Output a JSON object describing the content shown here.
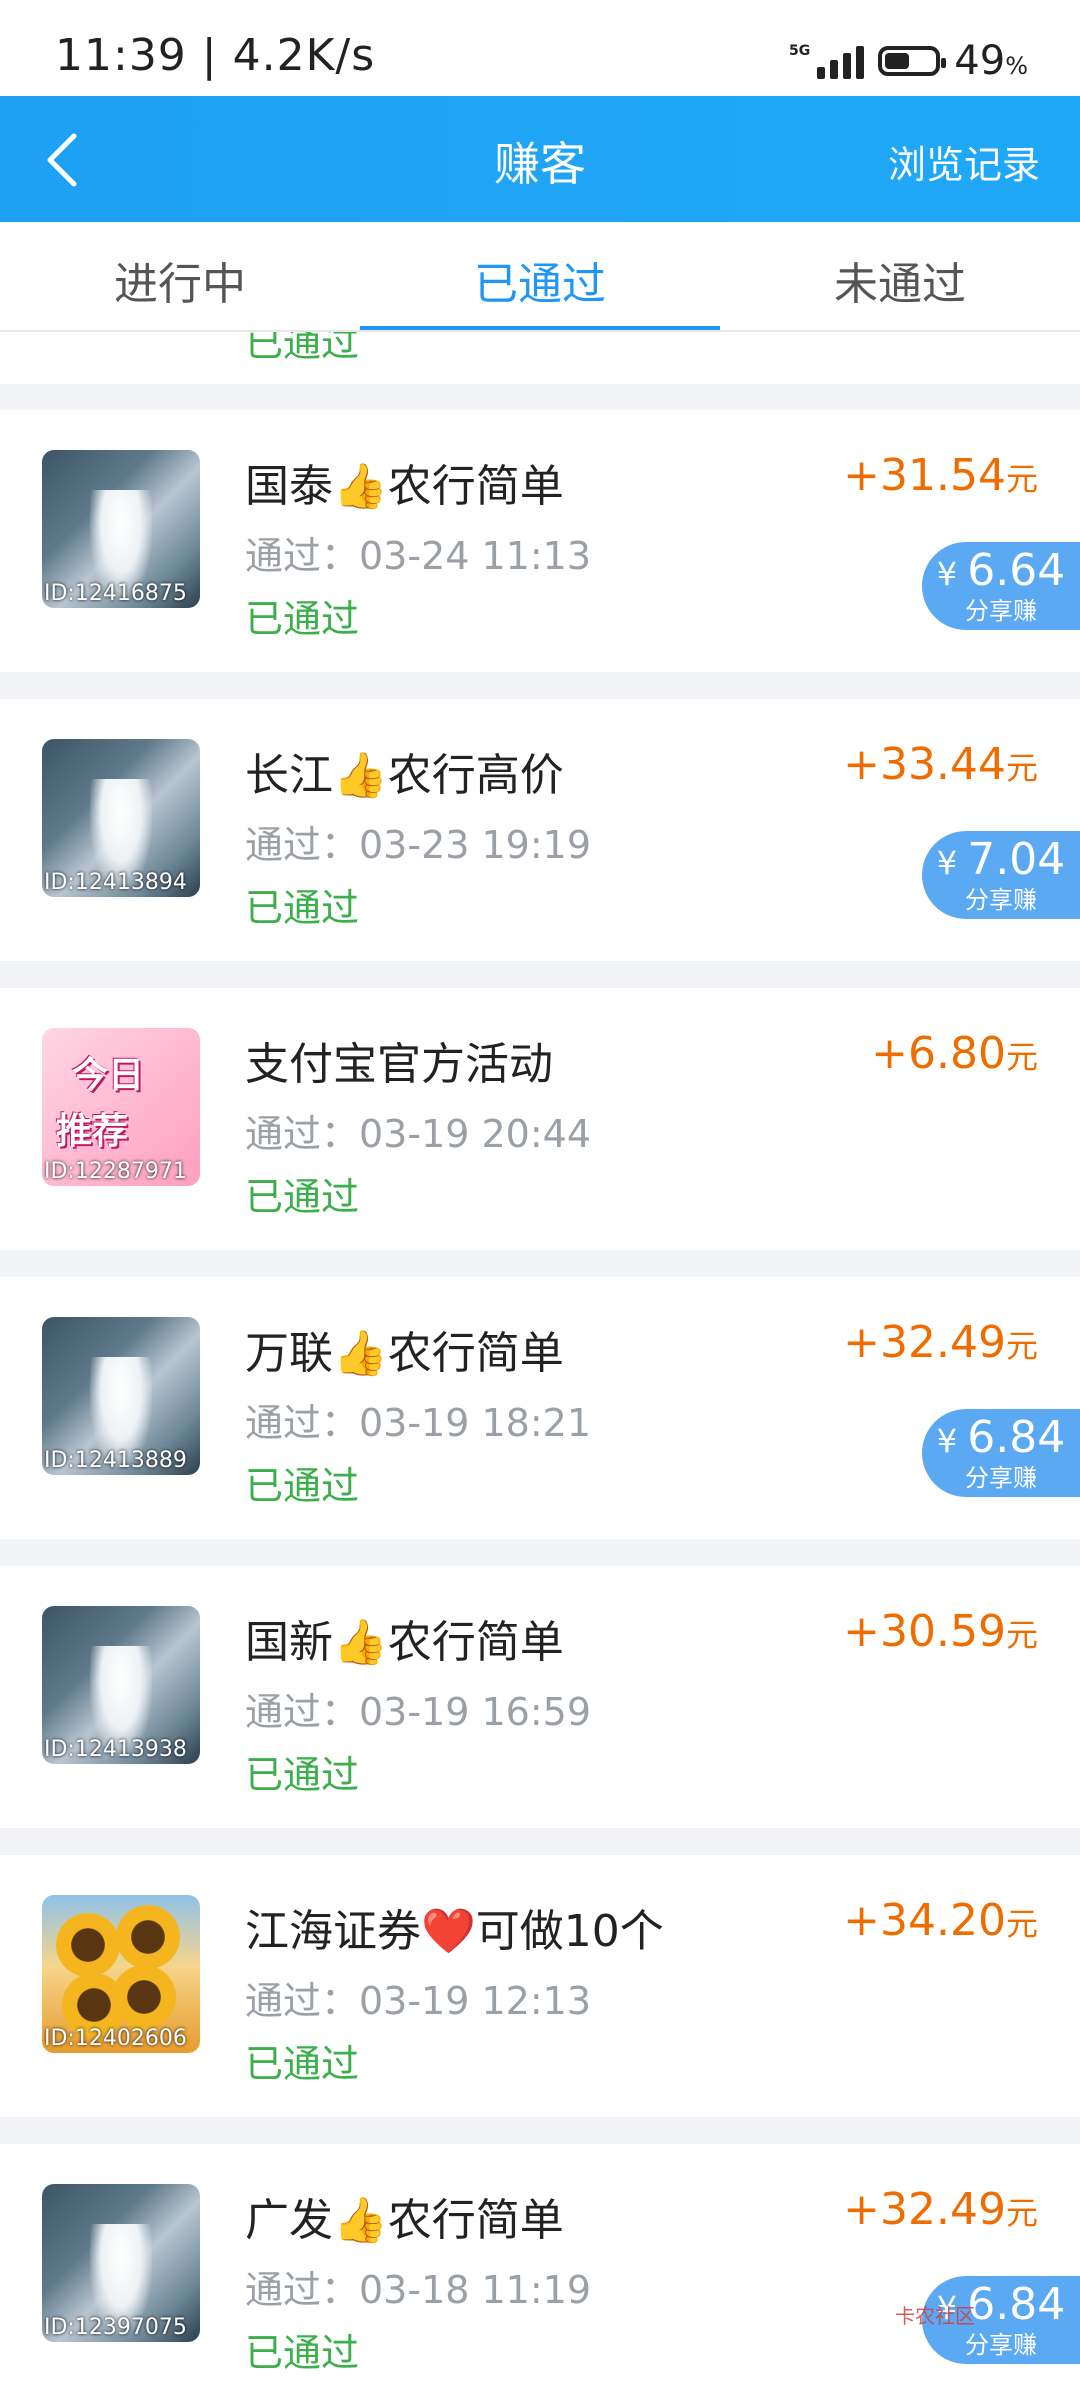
{
  "status_bar": {
    "time": "11:39 | 4.2K/s",
    "network": "5G",
    "battery": "49",
    "battery_unit": "%"
  },
  "header": {
    "title": "赚客",
    "right_link": "浏览记录",
    "back_icon": "chevron-left-icon"
  },
  "tabs": [
    {
      "label": "进行中"
    },
    {
      "label": "已通过"
    },
    {
      "label": "未通过"
    }
  ],
  "partial_row_status": "已通过",
  "tasks": [
    {
      "title": "国泰👍农行简单",
      "time": "通过：03-24 11:13",
      "status": "已通过",
      "amount": "+31.54",
      "unit": "元",
      "id": "ID:12416875",
      "thumb": "bride",
      "share": {
        "amount": "6.64",
        "label": "分享赚"
      }
    },
    {
      "title": "长江👍农行高价",
      "time": "通过：03-23 19:19",
      "status": "已通过",
      "amount": "+33.44",
      "unit": "元",
      "id": "ID:12413894",
      "thumb": "bride",
      "share": {
        "amount": "7.04",
        "label": "分享赚"
      }
    },
    {
      "title": "支付宝官方活动",
      "time": "通过：03-19 20:44",
      "status": "已通过",
      "amount": "+6.80",
      "unit": "元",
      "id": "ID:12287971",
      "thumb": "recommend",
      "thumb_text": [
        "今日",
        "推荐"
      ],
      "share": null
    },
    {
      "title": "万联👍农行简单",
      "time": "通过：03-19 18:21",
      "status": "已通过",
      "amount": "+32.49",
      "unit": "元",
      "id": "ID:12413889",
      "thumb": "bride",
      "share": {
        "amount": "6.84",
        "label": "分享赚"
      }
    },
    {
      "title": "国新👍农行简单",
      "time": "通过：03-19 16:59",
      "status": "已通过",
      "amount": "+30.59",
      "unit": "元",
      "id": "ID:12413938",
      "thumb": "bride",
      "share": null
    },
    {
      "title": "江海证券❤️可做10个",
      "time": "通过：03-19 12:13",
      "status": "已通过",
      "amount": "+34.20",
      "unit": "元",
      "id": "ID:12402606",
      "thumb": "sunflower",
      "share": null
    },
    {
      "title": "广发👍农行简单",
      "time": "通过：03-18 11:19",
      "status": "已通过",
      "amount": "+32.49",
      "unit": "元",
      "id": "ID:12397075",
      "thumb": "bride",
      "share": {
        "amount": "6.84",
        "label": "分享赚"
      }
    }
  ],
  "currency_symbol": "¥",
  "watermark": "卡农社区",
  "colors": {
    "header": "#1ea0f4",
    "tab_active": "#2196f3",
    "amount": "#ef6c00",
    "status": "#3cae4b",
    "share_badge": "#5aa9f2"
  }
}
